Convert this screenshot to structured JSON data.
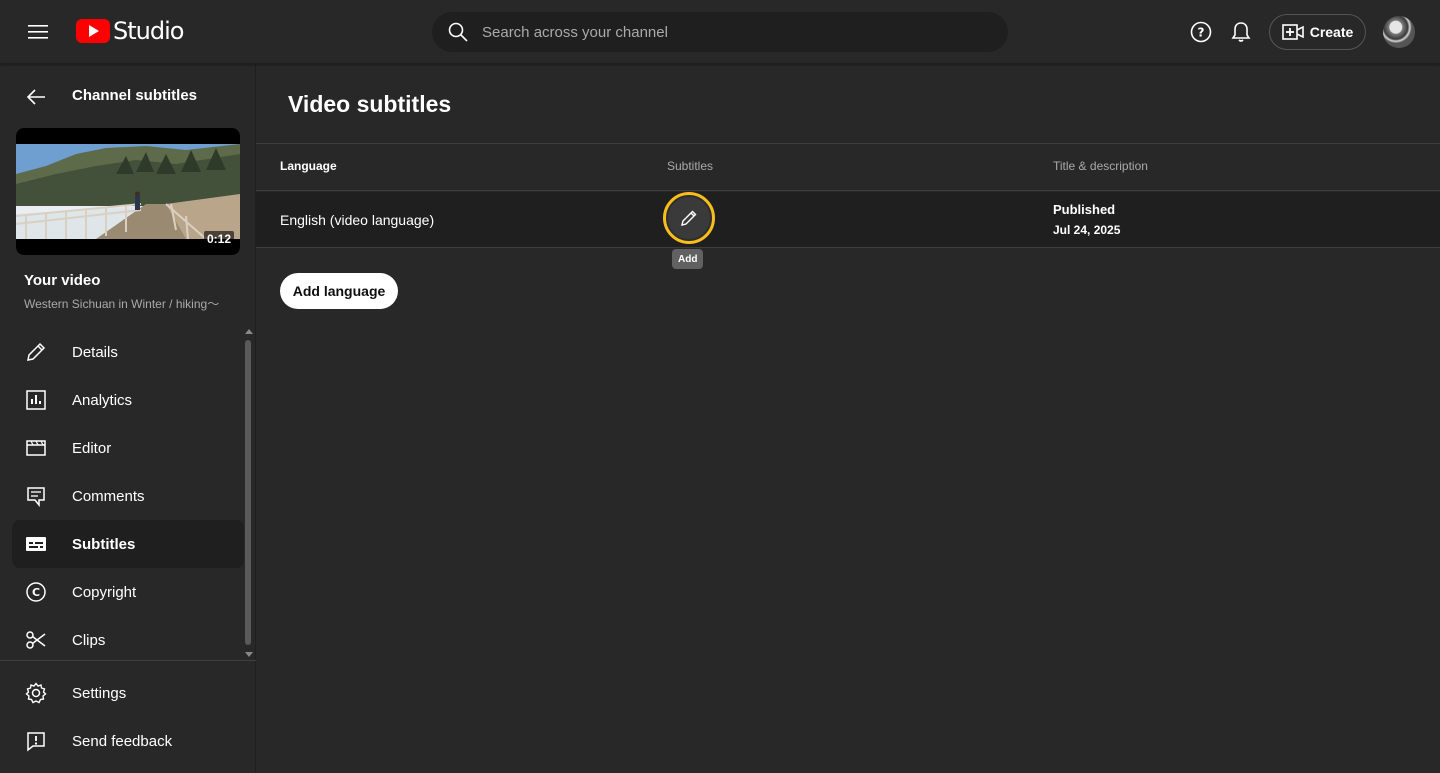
{
  "header": {
    "logo_text": "Studio",
    "search_placeholder": "Search across your channel",
    "create_label": "Create",
    "brand_color": "#ff0000"
  },
  "sidebar": {
    "back_title": "Channel subtitles",
    "video": {
      "duration": "0:12",
      "heading": "Your video",
      "name": "Western Sichuan in Winter / hiking～"
    },
    "items": [
      {
        "label": "Details",
        "icon": "pencil-icon"
      },
      {
        "label": "Analytics",
        "icon": "analytics-icon"
      },
      {
        "label": "Editor",
        "icon": "clapper-icon"
      },
      {
        "label": "Comments",
        "icon": "comment-icon"
      },
      {
        "label": "Subtitles",
        "icon": "subtitles-icon",
        "active": true
      },
      {
        "label": "Copyright",
        "icon": "copyright-icon"
      },
      {
        "label": "Clips",
        "icon": "scissors-icon"
      }
    ],
    "bottom_items": [
      {
        "label": "Settings",
        "icon": "gear-icon"
      },
      {
        "label": "Send feedback",
        "icon": "feedback-icon"
      }
    ]
  },
  "main": {
    "title": "Video subtitles",
    "columns": {
      "language": "Language",
      "subtitles": "Subtitles",
      "title_description": "Title & description"
    },
    "rows": [
      {
        "language": "English (video language)",
        "subtitles_tooltip": "Add",
        "status": "Published",
        "date": "Jul 24, 2025"
      }
    ],
    "add_language_label": "Add language",
    "highlight_color": "#f9be1b"
  }
}
